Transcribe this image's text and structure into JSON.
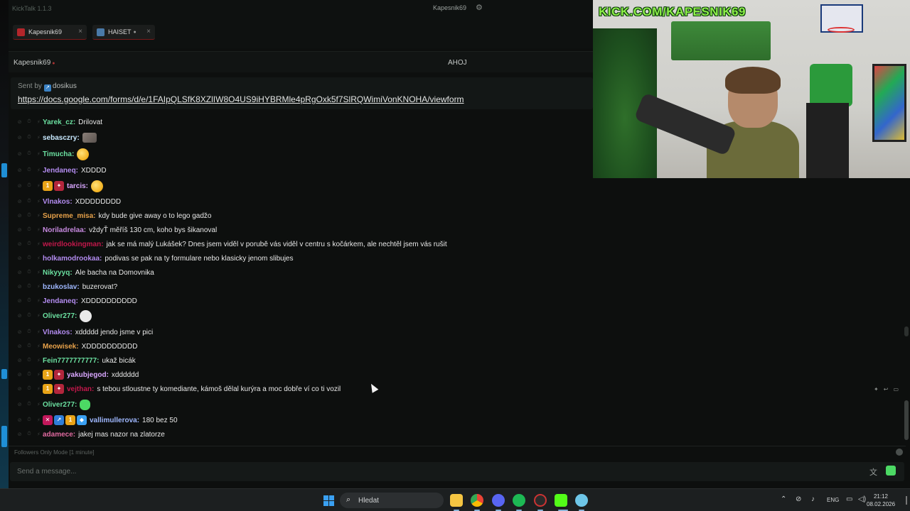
{
  "app": {
    "title": "KickTalk 1.1.3",
    "settings_icon": "gear-icon"
  },
  "titlebar": {
    "channel": "Kapesnik69"
  },
  "tabs": [
    {
      "label": "Kapesnik69",
      "close": "×",
      "avatar_color": "#b3262b"
    },
    {
      "label": "HAISET",
      "live": "●",
      "close": "×",
      "avatar_color": "#4a7aa8"
    }
  ],
  "channel_header": {
    "name": "Kapesnik69",
    "live_dot": "●",
    "stream_title": "AHOJ"
  },
  "pinned": {
    "sent_by_prefix": "Sent by",
    "user": "dosikus",
    "link": "https://docs.google.com/forms/d/e/1FAIpQLSfK8XZlIW8O4US9iHYBRMle4pRgOxk5f7SlRQWimiVonKNOHA/viewform"
  },
  "messages": [
    {
      "user": "Yarek_cz:",
      "color": "#6be0a0",
      "text": "Drilovat",
      "badges": []
    },
    {
      "user": "sebasczry:",
      "color": "#c8e9ff",
      "text": "",
      "emote": "rock",
      "badges": []
    },
    {
      "user": "Timucha:",
      "color": "#6be0a0",
      "text": "",
      "emote": "face",
      "badges": []
    },
    {
      "user": "Jendaneq:",
      "color": "#b38cf0",
      "text": "XDDDD",
      "badges": []
    },
    {
      "user": "tarcis:",
      "color": "#d9a7ff",
      "text": "",
      "emote": "face",
      "badges": [
        {
          "label": "1",
          "color": "#e8a317"
        },
        {
          "label": "✦",
          "color": "#b3263c"
        }
      ]
    },
    {
      "user": "Vlnakos:",
      "color": "#b38cf0",
      "text": "XDDDDDDDD",
      "badges": []
    },
    {
      "user": "Supreme_misa:",
      "color": "#e8a24a",
      "text": "kdy bude give away o to lego gadžo",
      "badges": []
    },
    {
      "user": "Noriladrelaa:",
      "color": "#c78ae0",
      "text": "vždyŤ měříš 130 cm, koho bys šikanoval",
      "badges": []
    },
    {
      "user": "weirdlookingman:",
      "color": "#c2184b",
      "text": "jak se má malý Lukášek? Dnes jsem viděl v porubě vás viděl v centru s kočárkem, ale nechtěl jsem vás rušit",
      "badges": []
    },
    {
      "user": "holkamodrookaa:",
      "color": "#b38cf0",
      "text": "podivas se pak na ty formulare nebo klasicky jenom slibujes",
      "badges": []
    },
    {
      "user": "Nikyyyq:",
      "color": "#6be0a0",
      "text": "Ale bacha na Domovnika",
      "badges": []
    },
    {
      "user": "bzukoslav:",
      "color": "#9fb8ff",
      "text": "buzerovat?",
      "badges": []
    },
    {
      "user": "Jendaneq:",
      "color": "#b38cf0",
      "text": "XDDDDDDDDDD",
      "badges": []
    },
    {
      "user": "Oliver277:",
      "color": "#6be0a0",
      "text": "",
      "emote": "skull",
      "badges": []
    },
    {
      "user": "Vlnakos:",
      "color": "#b38cf0",
      "text": "xddddd jendo jsme v pici",
      "badges": []
    },
    {
      "user": "Meowisek:",
      "color": "#e8a24a",
      "text": "XDDDDDDDDDD",
      "badges": []
    },
    {
      "user": "Fein7777777777:",
      "color": "#6be0a0",
      "text": "ukaž bicák",
      "badges": []
    },
    {
      "user": "yakubjegod:",
      "color": "#d9a7ff",
      "text": "xdddddd",
      "badges": [
        {
          "label": "1",
          "color": "#e8a317"
        },
        {
          "label": "✦",
          "color": "#b3263c"
        }
      ]
    },
    {
      "user": "vejthan:",
      "color": "#c2184b",
      "text": "s tebou stloustne ty komediante, kámoš dělal kurýra a moc dobře ví co ti vozil",
      "badges": [
        {
          "label": "1",
          "color": "#e8a317"
        },
        {
          "label": "✦",
          "color": "#b3263c"
        }
      ]
    },
    {
      "user": "Oliver277:",
      "color": "#6be0a0",
      "text": "",
      "emote": "green",
      "badges": []
    },
    {
      "user": "vallimullerova:",
      "color": "#9fb8ff",
      "text": "180 bez 50",
      "badges": [
        {
          "label": "✕",
          "color": "#c2185b"
        },
        {
          "label": "↗",
          "color": "#2f7ed8"
        },
        {
          "label": "1",
          "color": "#e8a317"
        },
        {
          "label": "◆",
          "color": "#3aa0f2"
        }
      ]
    },
    {
      "user": "adamece:",
      "color": "#e06aa0",
      "text": "jakej mas nazor na zlatorze",
      "badges": []
    }
  ],
  "followers_mode": "Followers Only Mode [1 minute]",
  "input": {
    "placeholder": "Send a message...",
    "translate_icon": "translate-icon",
    "emote_icon": "emote-picker-icon"
  },
  "video": {
    "caption": "KICK.COM/KAPESNIK69"
  },
  "taskbar": {
    "search_label": "Hledat",
    "language": "ENG",
    "time": "21:12",
    "date": "08.02.2026"
  },
  "colors": {
    "accent_kick": "#53fc18",
    "tab_border": "#7a1a1a"
  }
}
